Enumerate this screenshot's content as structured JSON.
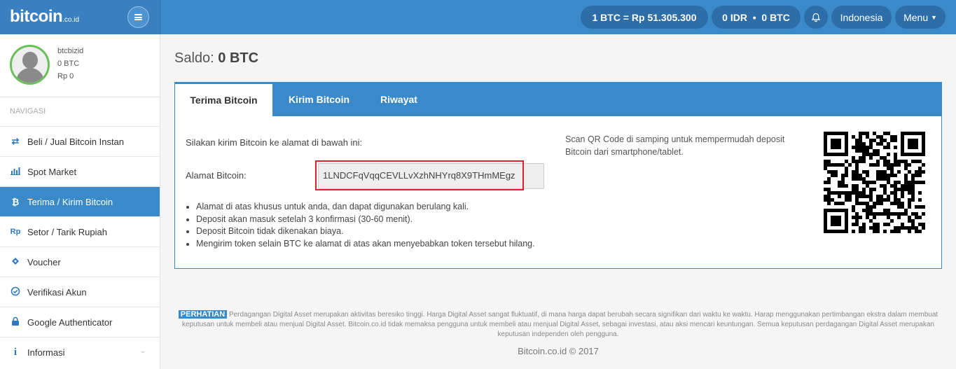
{
  "brand": {
    "name": "bitcoin",
    "suffix": ".co.id"
  },
  "header": {
    "rate": "1 BTC = Rp 51.305.300",
    "balance_idr": "0 IDR",
    "balance_sep": "•",
    "balance_btc": "0 BTC",
    "language": "Indonesia",
    "menu": "Menu"
  },
  "profile": {
    "username": "btcbizid",
    "btc": "0 BTC",
    "rp": "Rp 0"
  },
  "nav": {
    "heading": "NAVIGASI",
    "items": [
      {
        "label": "Beli / Jual Bitcoin Instan",
        "icon": "exchange-icon"
      },
      {
        "label": "Spot Market",
        "icon": "bar-chart-icon"
      },
      {
        "label": "Terima / Kirim Bitcoin",
        "icon": "bitcoin-icon"
      },
      {
        "label": "Setor / Tarik Rupiah",
        "icon": "rupiah-icon"
      },
      {
        "label": "Voucher",
        "icon": "ticket-icon"
      },
      {
        "label": "Verifikasi Akun",
        "icon": "check-circle-icon"
      },
      {
        "label": "Google Authenticator",
        "icon": "lock-icon"
      },
      {
        "label": "Informasi",
        "icon": "info-icon"
      }
    ]
  },
  "main": {
    "saldo_label": "Saldo:",
    "saldo_value": "0 BTC",
    "tabs": [
      "Terima Bitcoin",
      "Kirim Bitcoin",
      "Riwayat"
    ],
    "intro": "Silakan kirim Bitcoin ke alamat di bawah ini:",
    "address_label": "Alamat Bitcoin:",
    "address_value": "1LNDCFqVqqCEVLLvXzhNHYrq8X9THmMEgz",
    "bullets": [
      "Alamat di atas khusus untuk anda, dan dapat digunakan berulang kali.",
      "Deposit akan masuk setelah 3 konfirmasi (30-60 menit).",
      "Deposit Bitcoin tidak dikenakan biaya.",
      "Mengirim token selain BTC ke alamat di atas akan menyebabkan token tersebut hilang."
    ],
    "scan_text": "Scan QR Code di samping untuk mempermudah deposit Bitcoin dari smartphone/tablet."
  },
  "footer": {
    "badge": "PERHATIAN",
    "warning": "Perdagangan Digital Asset merupakan aktivitas beresiko tinggi. Harga Digital Asset sangat fluktuatif, di mana harga dapat berubah secara signifikan dari waktu ke waktu. Harap menggunakan pertimbangan ekstra dalam membuat keputusan untuk membeli atau menjual Digital Asset. Bitcoin.co.id tidak memaksa pengguna untuk membeli atau menjual Digital Asset, sebagai investasi, atau aksi mencari keuntungan. Semua keputusan perdagangan Digital Asset merupakan keputusan independen oleh pengguna.",
    "copyright": "Bitcoin.co.id © 2017"
  },
  "colors": {
    "primary": "#3a89c9",
    "pill": "#2d6ea8",
    "highlight": "#d9232d",
    "avatar_ring": "#6bbf59"
  }
}
